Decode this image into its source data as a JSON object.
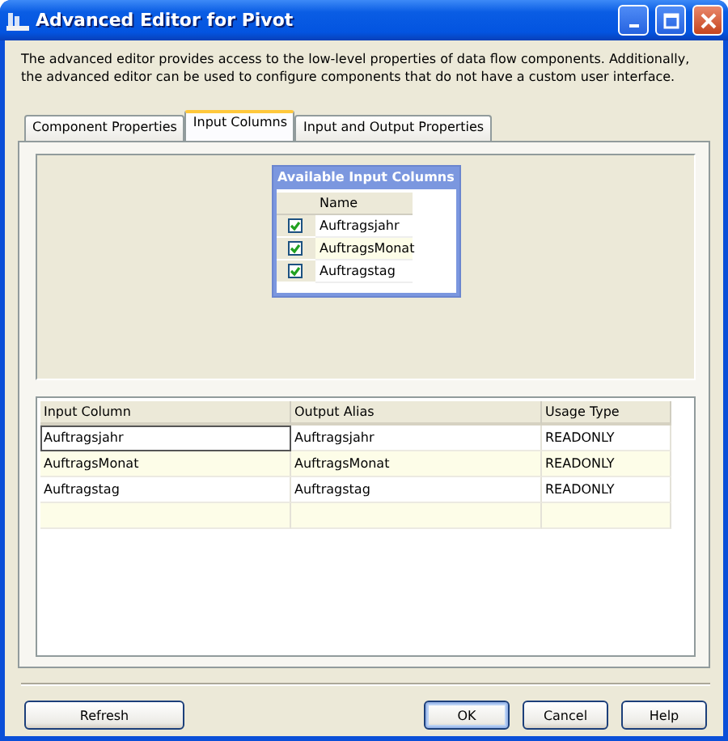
{
  "window": {
    "title": "Advanced Editor for Pivot"
  },
  "description": "The advanced editor provides access to the low-level properties of data flow components. Additionally, the advanced editor can be used to configure components that do not have a custom user interface.",
  "tabs": [
    {
      "label": "Component Properties",
      "selected": false
    },
    {
      "label": "Input Columns",
      "selected": true
    },
    {
      "label": "Input and Output Properties",
      "selected": false
    }
  ],
  "available_columns": {
    "title": "Available Input Columns",
    "header": "Name",
    "items": [
      {
        "name": "Auftragsjahr",
        "checked": true
      },
      {
        "name": "AuftragsMonat",
        "checked": true
      },
      {
        "name": "Auftragstag",
        "checked": true
      }
    ]
  },
  "grid": {
    "columns": [
      "Input Column",
      "Output Alias",
      "Usage Type"
    ],
    "rows": [
      {
        "cells": [
          "Auftragsjahr",
          "Auftragsjahr",
          "READONLY"
        ],
        "selected": true
      },
      {
        "cells": [
          "AuftragsMonat",
          "AuftragsMonat",
          "READONLY"
        ],
        "selected": false
      },
      {
        "cells": [
          "Auftragstag",
          "Auftragstag",
          "READONLY"
        ],
        "selected": false
      }
    ]
  },
  "buttons": [
    {
      "label": "Refresh",
      "default": false
    },
    {
      "label": "OK",
      "default": true
    },
    {
      "label": "Cancel",
      "default": false
    },
    {
      "label": "Help",
      "default": false
    }
  ]
}
